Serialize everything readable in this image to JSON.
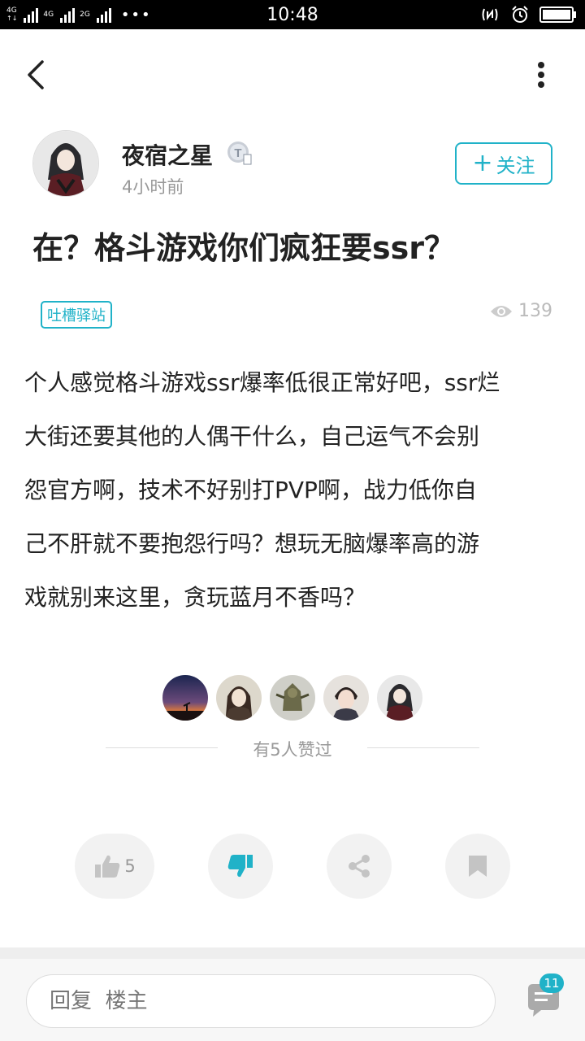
{
  "status_bar": {
    "network_1": "4G",
    "network_2": "4G",
    "network_3": "2G",
    "time": "10:48",
    "battery_level": 0.9
  },
  "nav": {
    "back_icon": "chevron-left-icon",
    "more_icon": "more-vertical-icon"
  },
  "author": {
    "name": "夜宿之星",
    "post_time": "4小时前",
    "follow_label": "关注",
    "follow_icon": "plus-icon",
    "level_badge": "T"
  },
  "post": {
    "title": "在？格斗游戏你们疯狂要ssr？",
    "tag": "吐槽驿站",
    "views": "139",
    "lines": [
      "个人感觉格斗游戏ssr爆率低很正常好吧，ssr烂",
      "大街还要其他的人偶干什么，自己运气不会别",
      "怨官方啊，技术不好别打PVP啊，战力低你自",
      "己不肝就不要抱怨行吗？想玩无脑爆率高的游",
      "戏就别来这里，贪玩蓝月不香吗？"
    ]
  },
  "likes": {
    "summary": "有5人赞过",
    "count": 5
  },
  "actions": {
    "like_count": "5",
    "like_icon": "thumbs-up-icon",
    "dislike_icon": "thumbs-down-icon",
    "share_icon": "share-icon",
    "bookmark_icon": "bookmark-icon",
    "accent_color": "#20b2c8"
  },
  "reply": {
    "placeholder": "回复  楼主",
    "comment_count": "11",
    "comment_icon": "comment-icon"
  }
}
